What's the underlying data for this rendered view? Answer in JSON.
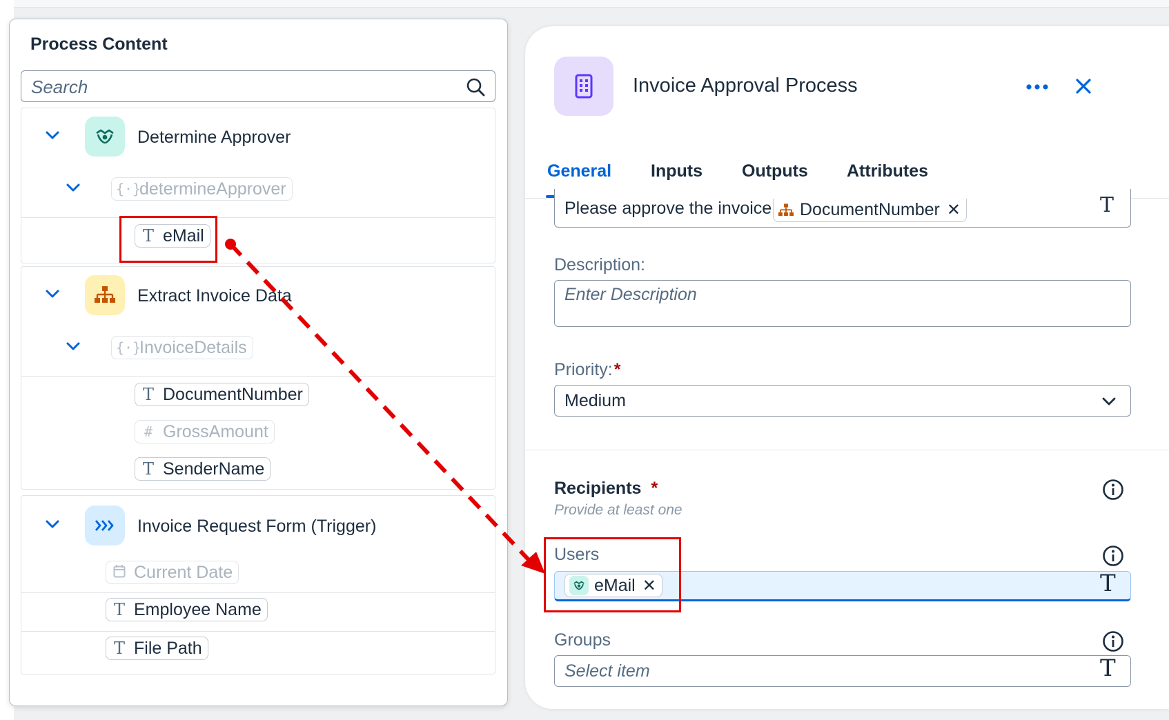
{
  "process_content": {
    "title": "Process Content",
    "search_placeholder": "Search",
    "groups": [
      {
        "name": "Determine Approver",
        "icon": "handshake-icon",
        "sub": "determineApprover",
        "items": [
          {
            "type": "text",
            "label": "eMail",
            "dim": false
          }
        ]
      },
      {
        "name": "Extract Invoice Data",
        "icon": "hierarchy-icon",
        "sub": "InvoiceDetails",
        "items": [
          {
            "type": "text",
            "label": "DocumentNumber",
            "dim": false
          },
          {
            "type": "number",
            "label": "GrossAmount",
            "dim": true
          },
          {
            "type": "text",
            "label": "SenderName",
            "dim": false
          }
        ]
      },
      {
        "name": "Invoice Request Form (Trigger)",
        "icon": "trigger-icon",
        "items": [
          {
            "type": "date",
            "label": "Current Date",
            "dim": true
          },
          {
            "type": "text",
            "label": "Employee Name",
            "dim": false
          },
          {
            "type": "text",
            "label": "File Path",
            "dim": false
          }
        ]
      }
    ]
  },
  "dialog": {
    "title": "Invoice Approval Process",
    "tabs": [
      "General",
      "Inputs",
      "Outputs",
      "Attributes"
    ],
    "active_tab": "General",
    "subject_field": {
      "text": "Please approve the invoice",
      "token": "DocumentNumber"
    },
    "description": {
      "label": "Description:",
      "placeholder": "Enter Description"
    },
    "priority": {
      "label": "Priority:",
      "required_mark": "*",
      "value": "Medium"
    },
    "recipients": {
      "title": "Recipients",
      "required_mark": "*",
      "hint": "Provide at least one",
      "users": {
        "label": "Users",
        "token": "eMail"
      },
      "groups": {
        "label": "Groups",
        "placeholder": "Select item"
      }
    }
  },
  "glyphs": {
    "text_type": "T",
    "number_type": "#",
    "remove": "✕"
  },
  "colors": {
    "accent": "#0064d9",
    "annotation_red": "#e30000",
    "handshake_bg": "#c9f4ec",
    "hierarchy_bg": "#fff0b3",
    "trigger_bg": "#d6ecff",
    "dialog_icon_bg": "#e6dcfb",
    "focused_field_bg": "#e5f2ff"
  }
}
